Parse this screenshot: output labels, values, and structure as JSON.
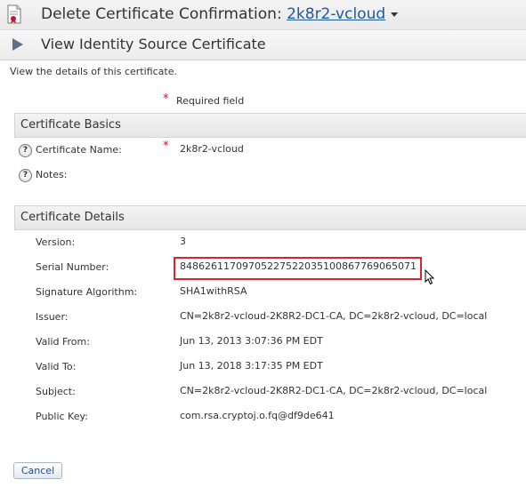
{
  "header": {
    "title_prefix": "Delete Certificate Confirmation: ",
    "title_link": "2k8r2-vcloud"
  },
  "subheader": {
    "title": "View Identity Source Certificate"
  },
  "description": "View the details of this certificate.",
  "required": {
    "star": "*",
    "text": "Required field"
  },
  "basics": {
    "heading": "Certificate Basics",
    "name_label": "Certificate Name:",
    "name_star": "*",
    "name_value": "2k8r2-vcloud",
    "notes_label": "Notes:",
    "help_glyph": "?"
  },
  "details": {
    "heading": "Certificate Details",
    "rows": [
      {
        "label": "Version:",
        "value": "3"
      },
      {
        "label": "Serial Number:",
        "value": "84862611709705227522035100867769065071"
      },
      {
        "label": "Signature Algorithm:",
        "value": "SHA1withRSA"
      },
      {
        "label": "Issuer:",
        "value": "CN=2k8r2-vcloud-2K8R2-DC1-CA, DC=2k8r2-vcloud, DC=local"
      },
      {
        "label": "Valid From:",
        "value": "Jun 13, 2013 3:07:36 PM EDT"
      },
      {
        "label": "Valid To:",
        "value": "Jun 13, 2018 3:17:35 PM EDT"
      },
      {
        "label": "Subject:",
        "value": "CN=2k8r2-vcloud-2K8R2-DC1-CA, DC=2k8r2-vcloud, DC=local"
      },
      {
        "label": "Public Key:",
        "value": "com.rsa.cryptoj.o.fq@df9de641"
      }
    ]
  },
  "footer": {
    "cancel_label": "Cancel"
  },
  "colors": {
    "link": "#1c5a9e",
    "required": "#c0172d",
    "highlight": "#d9232e"
  }
}
